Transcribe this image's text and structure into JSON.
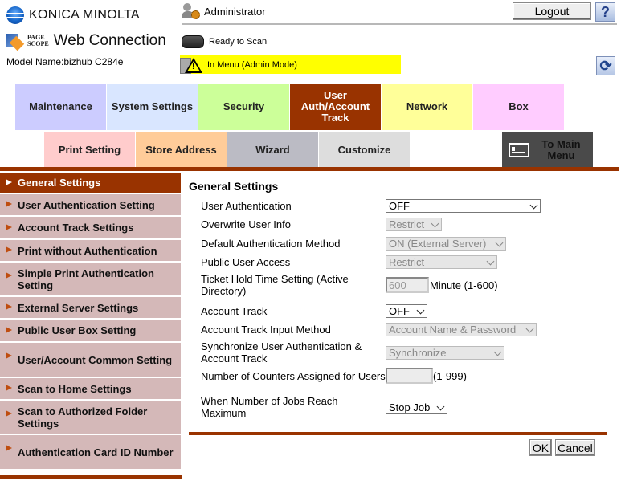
{
  "header": {
    "brand": "KONICA MINOLTA",
    "product_small_top": "PAGE",
    "product_small_bottom": "SCOPE",
    "product": "Web Connection",
    "model": "Model Name:bizhub C284e",
    "user": "Administrator",
    "scan_status": "Ready to Scan",
    "mode_status": "In Menu (Admin Mode)",
    "logout_label": "Logout",
    "help_label": "?",
    "refresh_label": "⟳"
  },
  "tabs_row1": [
    {
      "label": "Maintenance",
      "color": "#ccccff"
    },
    {
      "label": "System Settings",
      "color": "#d9e6ff"
    },
    {
      "label": "Security",
      "color": "#ccff99"
    },
    {
      "label": "User Auth/Account Track",
      "color": "#993300",
      "active": true
    },
    {
      "label": "Network",
      "color": "#ffff99"
    },
    {
      "label": "Box",
      "color": "#ffccff"
    }
  ],
  "tabs_row2": [
    {
      "label": "Print Setting",
      "color": "#ffcccc"
    },
    {
      "label": "Store Address",
      "color": "#ffcc99"
    },
    {
      "label": "Wizard",
      "color": "#bbbbc4"
    },
    {
      "label": "Customize",
      "color": "#dddddd"
    }
  ],
  "main_menu_label": "To Main Menu",
  "sidebar": {
    "items": [
      {
        "label": "General Settings",
        "selected": true
      },
      {
        "label": "User Authentication Setting"
      },
      {
        "label": "Account Track Settings"
      },
      {
        "label": "Print without Authentication"
      },
      {
        "label": "Simple Print Authentication Setting"
      },
      {
        "label": "External Server Settings"
      },
      {
        "label": "Public User Box Setting"
      },
      {
        "label": "User/Account Common Setting"
      },
      {
        "label": "Scan to Home Settings"
      },
      {
        "label": "Scan to Authorized Folder Settings"
      },
      {
        "label": "Authentication Card ID Number"
      }
    ]
  },
  "content": {
    "title": "General Settings",
    "fields": [
      {
        "label": "User Authentication",
        "value": "OFF",
        "type": "select",
        "disabled": false
      },
      {
        "label": "Overwrite User Info",
        "value": "Restrict",
        "type": "select",
        "disabled": true
      },
      {
        "label": "Default Authentication Method",
        "value": "ON (External Server)",
        "type": "select",
        "disabled": true
      },
      {
        "label": "Public User Access",
        "value": "Restrict",
        "type": "select",
        "disabled": true
      },
      {
        "label": "Ticket Hold Time Setting (Active Directory)",
        "value": "600",
        "suffix": "Minute (1-600)",
        "type": "text",
        "disabled": true
      },
      {
        "label": "Account Track",
        "value": "OFF",
        "type": "select",
        "disabled": false
      },
      {
        "label": "Account Track Input Method",
        "value": "Account Name & Password",
        "type": "select",
        "disabled": true
      },
      {
        "label": "Synchronize User Authentication & Account Track",
        "value": "Synchronize",
        "type": "select",
        "disabled": true
      },
      {
        "label": "Number of Counters Assigned for Users",
        "value": "",
        "suffix": "(1-999)",
        "type": "text",
        "disabled": true
      },
      {
        "label": "When Number of Jobs Reach Maximum",
        "value": "Stop Job",
        "type": "select",
        "disabled": false
      }
    ],
    "ok_label": "OK",
    "cancel_label": "Cancel"
  }
}
